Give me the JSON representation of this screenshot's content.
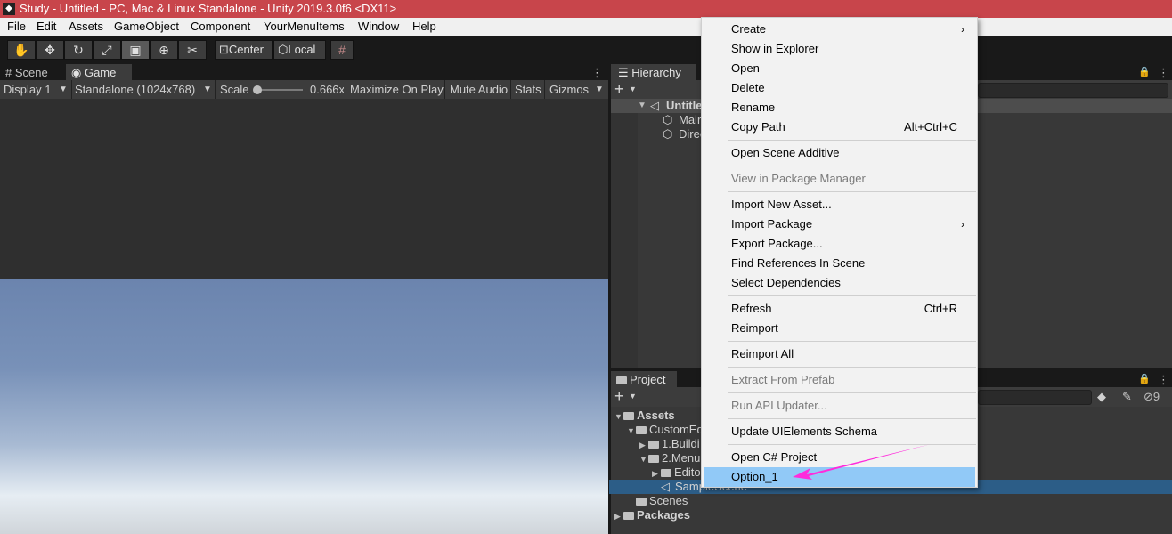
{
  "window": {
    "title": "Study - Untitled - PC, Mac & Linux Standalone - Unity 2019.3.0f6 <DX11>",
    "logo_glyph": "◆"
  },
  "menubar": [
    "File",
    "Edit",
    "Assets",
    "GameObject",
    "Component",
    "YourMenuItems",
    "Window",
    "Help"
  ],
  "toolbar": {
    "tool_icons": {
      "hand": "✋",
      "move": "✥",
      "rotate": "↻",
      "scale": "⤢",
      "rect": "▣",
      "transform": "⊕",
      "custom": "✂"
    },
    "pivot_label": "Center",
    "space_label": "Local",
    "snap_icon": "#"
  },
  "left_panel": {
    "tabs": [
      "Scene",
      "Game"
    ],
    "tab_icons": {
      "scene": "#",
      "game": "◉"
    },
    "display": "Display 1",
    "resolution": "Standalone (1024x768)",
    "scale_label": "Scale",
    "scale_value": "0.666x",
    "maximize": "Maximize On Play",
    "mute": "Mute Audio",
    "stats": "Stats",
    "gizmos": "Gizmos",
    "more_icon": "⋮",
    "dropdown_arrow": "▼"
  },
  "hierarchy": {
    "tab": "Hierarchy",
    "add_icon": "+",
    "lock_icon": "🔒",
    "scene": "Untitled",
    "items": [
      "Main Camera",
      "Directional Light"
    ],
    "visible_items": [
      "Mair",
      "Direc"
    ]
  },
  "project": {
    "tab": "Project",
    "count_label": "9",
    "tree": {
      "assets": "Assets",
      "custom": "CustomEd",
      "building": "1.Buildi",
      "menu": "2.Menu",
      "editor": "Edito",
      "sample": "SampleScene",
      "scenes": "Scenes",
      "packages": "Packages"
    }
  },
  "context_menu": {
    "items": [
      {
        "label": "Create",
        "submenu": true
      },
      {
        "label": "Show in Explorer"
      },
      {
        "label": "Open"
      },
      {
        "label": "Delete"
      },
      {
        "label": "Rename"
      },
      {
        "label": "Copy Path",
        "shortcut": "Alt+Ctrl+C"
      },
      {
        "label": "Open Scene Additive"
      },
      {
        "label": "View in Package Manager",
        "disabled": true
      },
      {
        "label": "Import New Asset..."
      },
      {
        "label": "Import Package",
        "submenu": true
      },
      {
        "label": "Export Package..."
      },
      {
        "label": "Find References In Scene"
      },
      {
        "label": "Select Dependencies"
      },
      {
        "label": "Refresh",
        "shortcut": "Ctrl+R"
      },
      {
        "label": "Reimport"
      },
      {
        "label": "Reimport All"
      },
      {
        "label": "Extract From Prefab",
        "disabled": true
      },
      {
        "label": "Run API Updater...",
        "disabled": true
      },
      {
        "label": "Update UIElements Schema"
      },
      {
        "label": "Open C# Project"
      },
      {
        "label": "Option_1",
        "highlighted": true
      }
    ],
    "submenu_arrow": "›"
  },
  "annotation": {
    "color": "#ff2bdc"
  }
}
